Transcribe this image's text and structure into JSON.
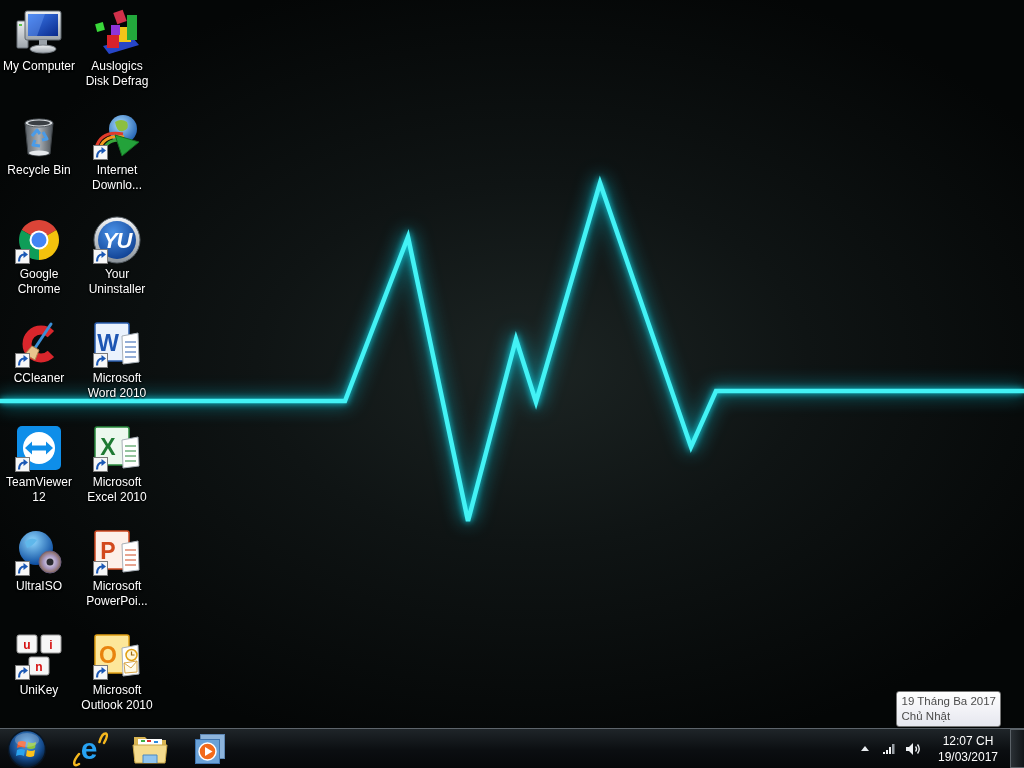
{
  "desktop": {
    "icons": [
      {
        "label": "My Computer",
        "kind": "monitor",
        "shortcut": false
      },
      {
        "label": "Recycle Bin",
        "kind": "bin",
        "shortcut": false
      },
      {
        "label": "Google Chrome",
        "kind": "browser",
        "shortcut": true
      },
      {
        "label": "CCleaner",
        "kind": "cleaner",
        "shortcut": true
      },
      {
        "label": "TeamViewer 12",
        "kind": "remote",
        "shortcut": true
      },
      {
        "label": "UltraISO",
        "kind": "disc",
        "shortcut": true
      },
      {
        "label": "UniKey",
        "kind": "keys",
        "letters": [
          "u",
          "i",
          "n"
        ],
        "shortcut": true
      },
      {
        "label": "Auslogics Disk Defrag",
        "kind": "blocks",
        "shortcut": false
      },
      {
        "label": "Internet Downlo...",
        "kind": "download",
        "shortcut": true
      },
      {
        "label": "Your Uninstaller",
        "kind": "badge",
        "letters": [
          "YU"
        ],
        "shortcut": true
      },
      {
        "label": "Microsoft Word 2010",
        "kind": "writer",
        "letters": [
          "W"
        ],
        "shortcut": true
      },
      {
        "label": "Microsoft Excel 2010",
        "kind": "sheet",
        "letters": [
          "X"
        ],
        "shortcut": true
      },
      {
        "label": "Microsoft PowerPoi...",
        "kind": "slides",
        "letters": [
          "P"
        ],
        "shortcut": true
      },
      {
        "label": "Microsoft Outlook 2010",
        "kind": "mail",
        "letters": [
          "O"
        ],
        "shortcut": true
      }
    ]
  },
  "tooltip": {
    "lines": [
      "19 Tháng Ba 2017",
      "Chủ Nhật"
    ]
  },
  "taskbar": {
    "pinned": [
      {
        "kind": "browser",
        "letters": [
          "e"
        ]
      },
      {
        "kind": "folder"
      },
      {
        "kind": "player"
      }
    ],
    "tray": [
      {
        "kind": "caret"
      },
      {
        "kind": "signal"
      },
      {
        "kind": "volume"
      }
    ],
    "clock": {
      "time": "12:07 CH",
      "date": "19/03/2017"
    }
  }
}
